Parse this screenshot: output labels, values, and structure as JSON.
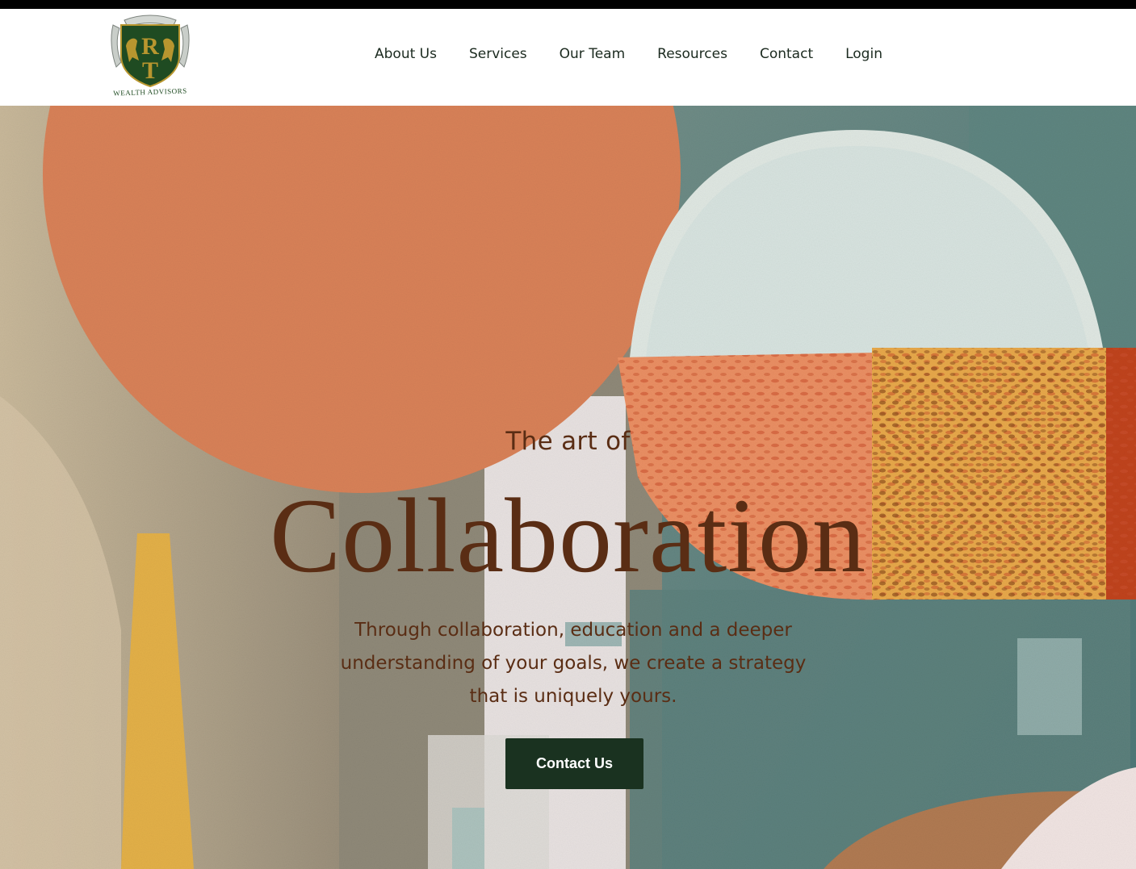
{
  "brand": {
    "logo_icon": "crest-shield-icon",
    "logo_letters": "RT",
    "logo_caption": "WEALTH ADVISORS",
    "colors": {
      "shield": "#1f4b22",
      "gold": "#b8962f"
    }
  },
  "nav": {
    "items": [
      {
        "label": "About Us"
      },
      {
        "label": "Services"
      },
      {
        "label": "Our Team"
      },
      {
        "label": "Resources"
      },
      {
        "label": "Contact"
      },
      {
        "label": "Login"
      }
    ]
  },
  "hero": {
    "kicker": "The art of",
    "headline": "Collaboration",
    "subtext": "Through collaboration, education and a deeper understanding of your goals, we create a strategy that is uniquely yours.",
    "cta_label": "Contact Us",
    "text_color": "#5a2d14",
    "cta_color": "#1a3220"
  }
}
